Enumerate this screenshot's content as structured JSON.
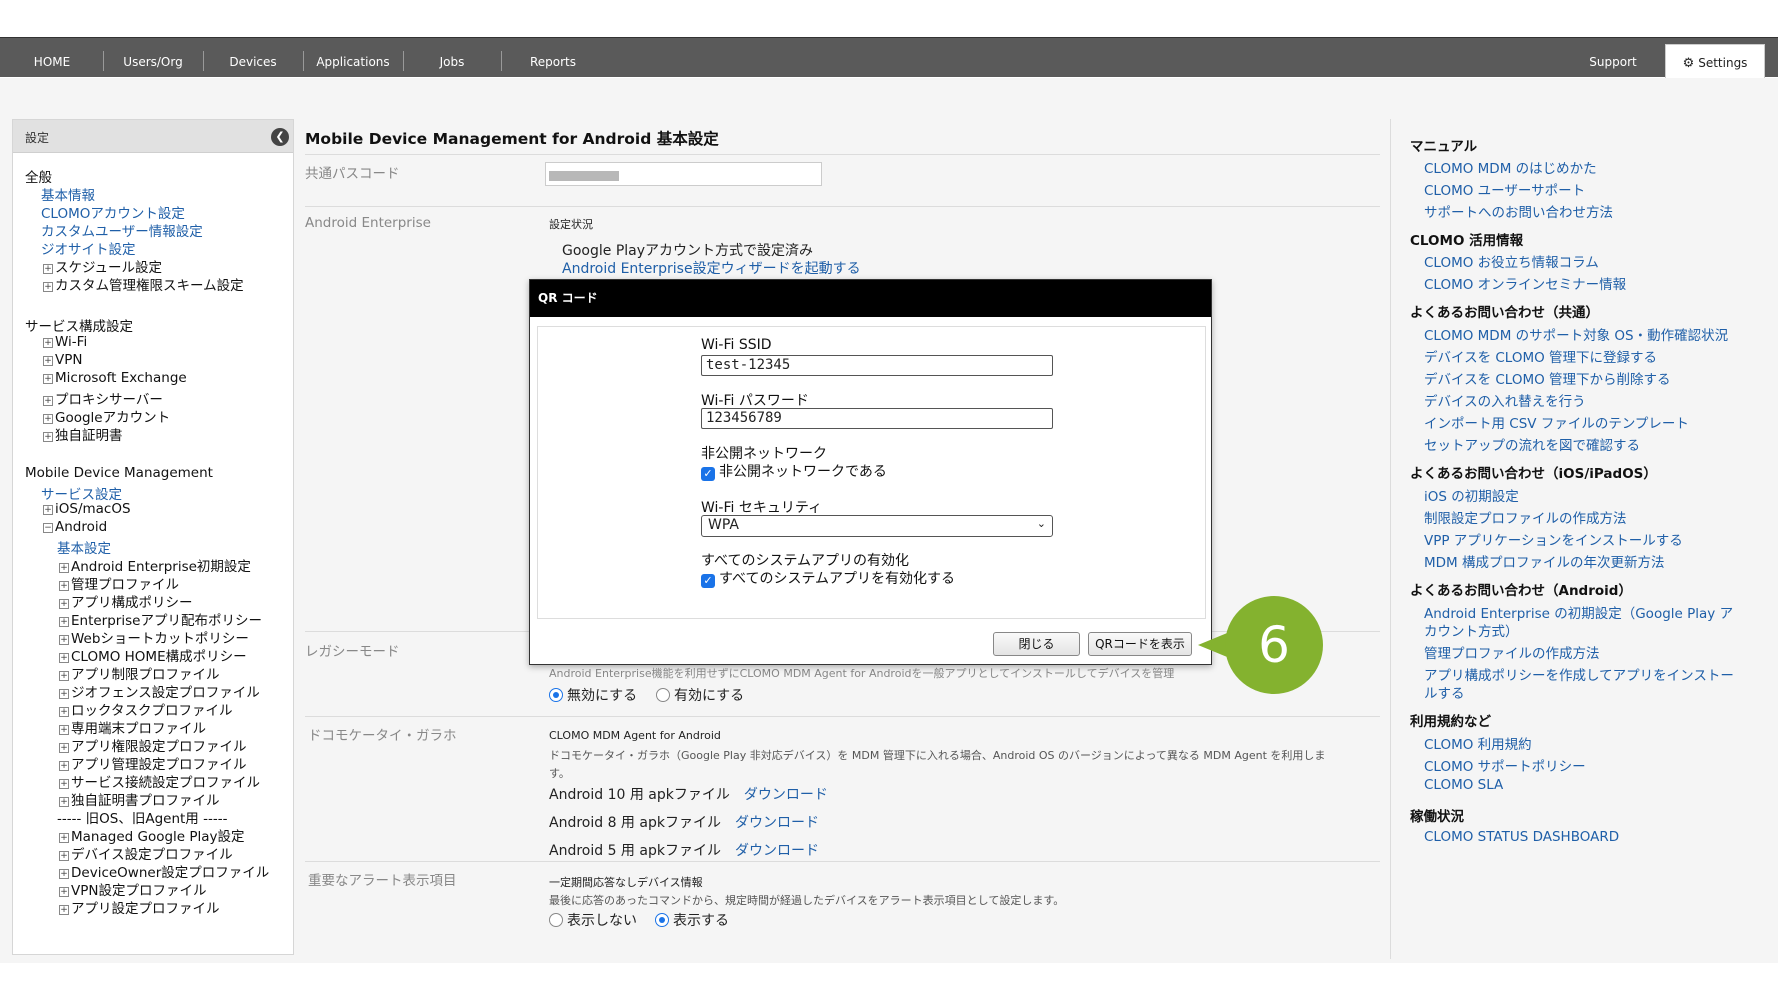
{
  "nav": {
    "items": [
      "HOME",
      "Users/Org",
      "Devices",
      "Applications",
      "Jobs",
      "Reports"
    ],
    "support": "Support",
    "settings": "Settings"
  },
  "sidebar": {
    "header": "設定",
    "general_title": "全般",
    "general_items": [
      "基本情報",
      "CLOMOアカウント設定",
      "カスタムユーザー情報設定",
      "ジオサイト設定"
    ],
    "general_expand": [
      "スケジュール設定",
      "カスタム管理権限スキーム設定"
    ],
    "service_title": "サービス構成設定",
    "service_items": [
      "Wi-Fi",
      "VPN",
      "Microsoft Exchange",
      "プロキシサーバー",
      "Googleアカウント",
      "独自証明書"
    ],
    "mdm_title": "Mobile Device Management",
    "mdm_service": "サービス設定",
    "mdm_ios": "iOS/macOS",
    "mdm_android": "Android",
    "android_basic": "基本設定",
    "android_items": [
      "Android Enterprise初期設定",
      "管理プロファイル",
      "アプリ構成ポリシー",
      "Enterpriseアプリ配布ポリシー",
      "Webショートカットポリシー",
      "CLOMO HOME構成ポリシー",
      "アプリ制限プロファイル",
      "ジオフェンス設定プロファイル",
      "ロックタスクプロファイル",
      "専用端末プロファイル",
      "アプリ権限設定プロファイル",
      "アプリ管理設定プロファイル",
      "サービス接続設定プロファイル",
      "独自証明書プロファイル"
    ],
    "old_separator": "----- 旧OS、旧Agent用 -----",
    "old_items": [
      "Managed Google Play設定",
      "デバイス設定プロファイル",
      "DeviceOwner設定プロファイル",
      "VPN設定プロファイル",
      "アプリ設定プロファイル"
    ]
  },
  "main": {
    "title": "Mobile Device Management for Android 基本設定",
    "passcode_label": "共通パスコード",
    "ae_label": "Android Enterprise",
    "ae_status_label": "設定状況",
    "ae_status": "Google Playアカウント方式で設定済み",
    "ae_wizard_link": "Android Enterprise設定ウィザードを起動する",
    "legacy_label": "レガシーモード",
    "legacy_desc": "Android Enterprise機能を利用せずにCLOMO MDM Agent for Androidを一般アプリとしてインストールしてデバイスを管理",
    "legacy_off": "無効にする",
    "legacy_on": "有効にする",
    "docomo_label": "ドコモケータイ・ガラホ",
    "docomo_agent_title": "CLOMO MDM Agent for Android",
    "docomo_desc1": "ドコモケータイ・ガラホ（Google Play 非対応デバイス）を MDM 管理下に入れる場合、Android OS のバージョンによって異なる MDM Agent を利用しま",
    "docomo_desc2": "す。",
    "apk": [
      {
        "label": "Android 10 用 apkファイル",
        "link": "ダウンロード"
      },
      {
        "label": "Android 8 用 apkファイル",
        "link": "ダウンロード"
      },
      {
        "label": "Android 5 用 apkファイル",
        "link": "ダウンロード"
      }
    ],
    "alert_label": "重要なアラート表示項目",
    "alert_title": "一定期間応答なしデバイス情報",
    "alert_desc": "最後に応答のあったコマンドから、規定時間が経過したデバイスをアラート表示項目として設定します。",
    "alert_off": "表示しない",
    "alert_on": "表示する"
  },
  "dialog": {
    "title": "QR コード",
    "ssid_label": "Wi-Fi SSID",
    "ssid_value": "test-12345",
    "password_label": "Wi-Fi パスワード",
    "password_value": "123456789",
    "hidden_label": "非公開ネットワーク",
    "hidden_check": "非公開ネットワークである",
    "security_label": "Wi-Fi セキュリティ",
    "security_value": "WPA",
    "sysapps_label": "すべてのシステムアプリの有効化",
    "sysapps_check": "すべてのシステムアプリを有効化する",
    "close_btn": "閉じる",
    "show_btn": "QRコードを表示"
  },
  "callout": "6",
  "right": {
    "manual_title": "マニュアル",
    "manual_links": [
      "CLOMO MDM のはじめかた",
      "CLOMO ユーザーサポート",
      "サポートへのお問い合わせ方法"
    ],
    "use_title": "CLOMO 活用情報",
    "use_links": [
      "CLOMO お役立ち情報コラム",
      "CLOMO オンラインセミナー情報"
    ],
    "faq_common_title": "よくあるお問い合わせ（共通）",
    "faq_common_links": [
      "CLOMO MDM のサポート対象 OS・動作確認状況",
      "デバイスを CLOMO 管理下に登録する",
      "デバイスを CLOMO 管理下から削除する",
      "デバイスの入れ替えを行う",
      "インポート用 CSV ファイルのテンプレート",
      "セットアップの流れを図で確認する"
    ],
    "faq_ios_title": "よくあるお問い合わせ（iOS/iPadOS）",
    "faq_ios_links": [
      "iOS の初期設定",
      "制限設定プロファイルの作成方法",
      "VPP アプリケーションをインストールする",
      "MDM 構成プロファイルの年次更新方法"
    ],
    "faq_android_title": "よくあるお問い合わせ（Android）",
    "faq_android_links": [
      "Android Enterprise の初期設定（Google Play ア",
      "カウント方式）",
      "管理プロファイルの作成方法",
      "アプリ構成ポリシーを作成してアプリをインストー",
      "ルする"
    ],
    "terms_title": "利用規約など",
    "terms_links": [
      "CLOMO 利用規約",
      "CLOMO サポートポリシー",
      "CLOMO SLA"
    ],
    "status_title": "稼働状況",
    "status_links": [
      "CLOMO STATUS DASHBOARD"
    ]
  }
}
